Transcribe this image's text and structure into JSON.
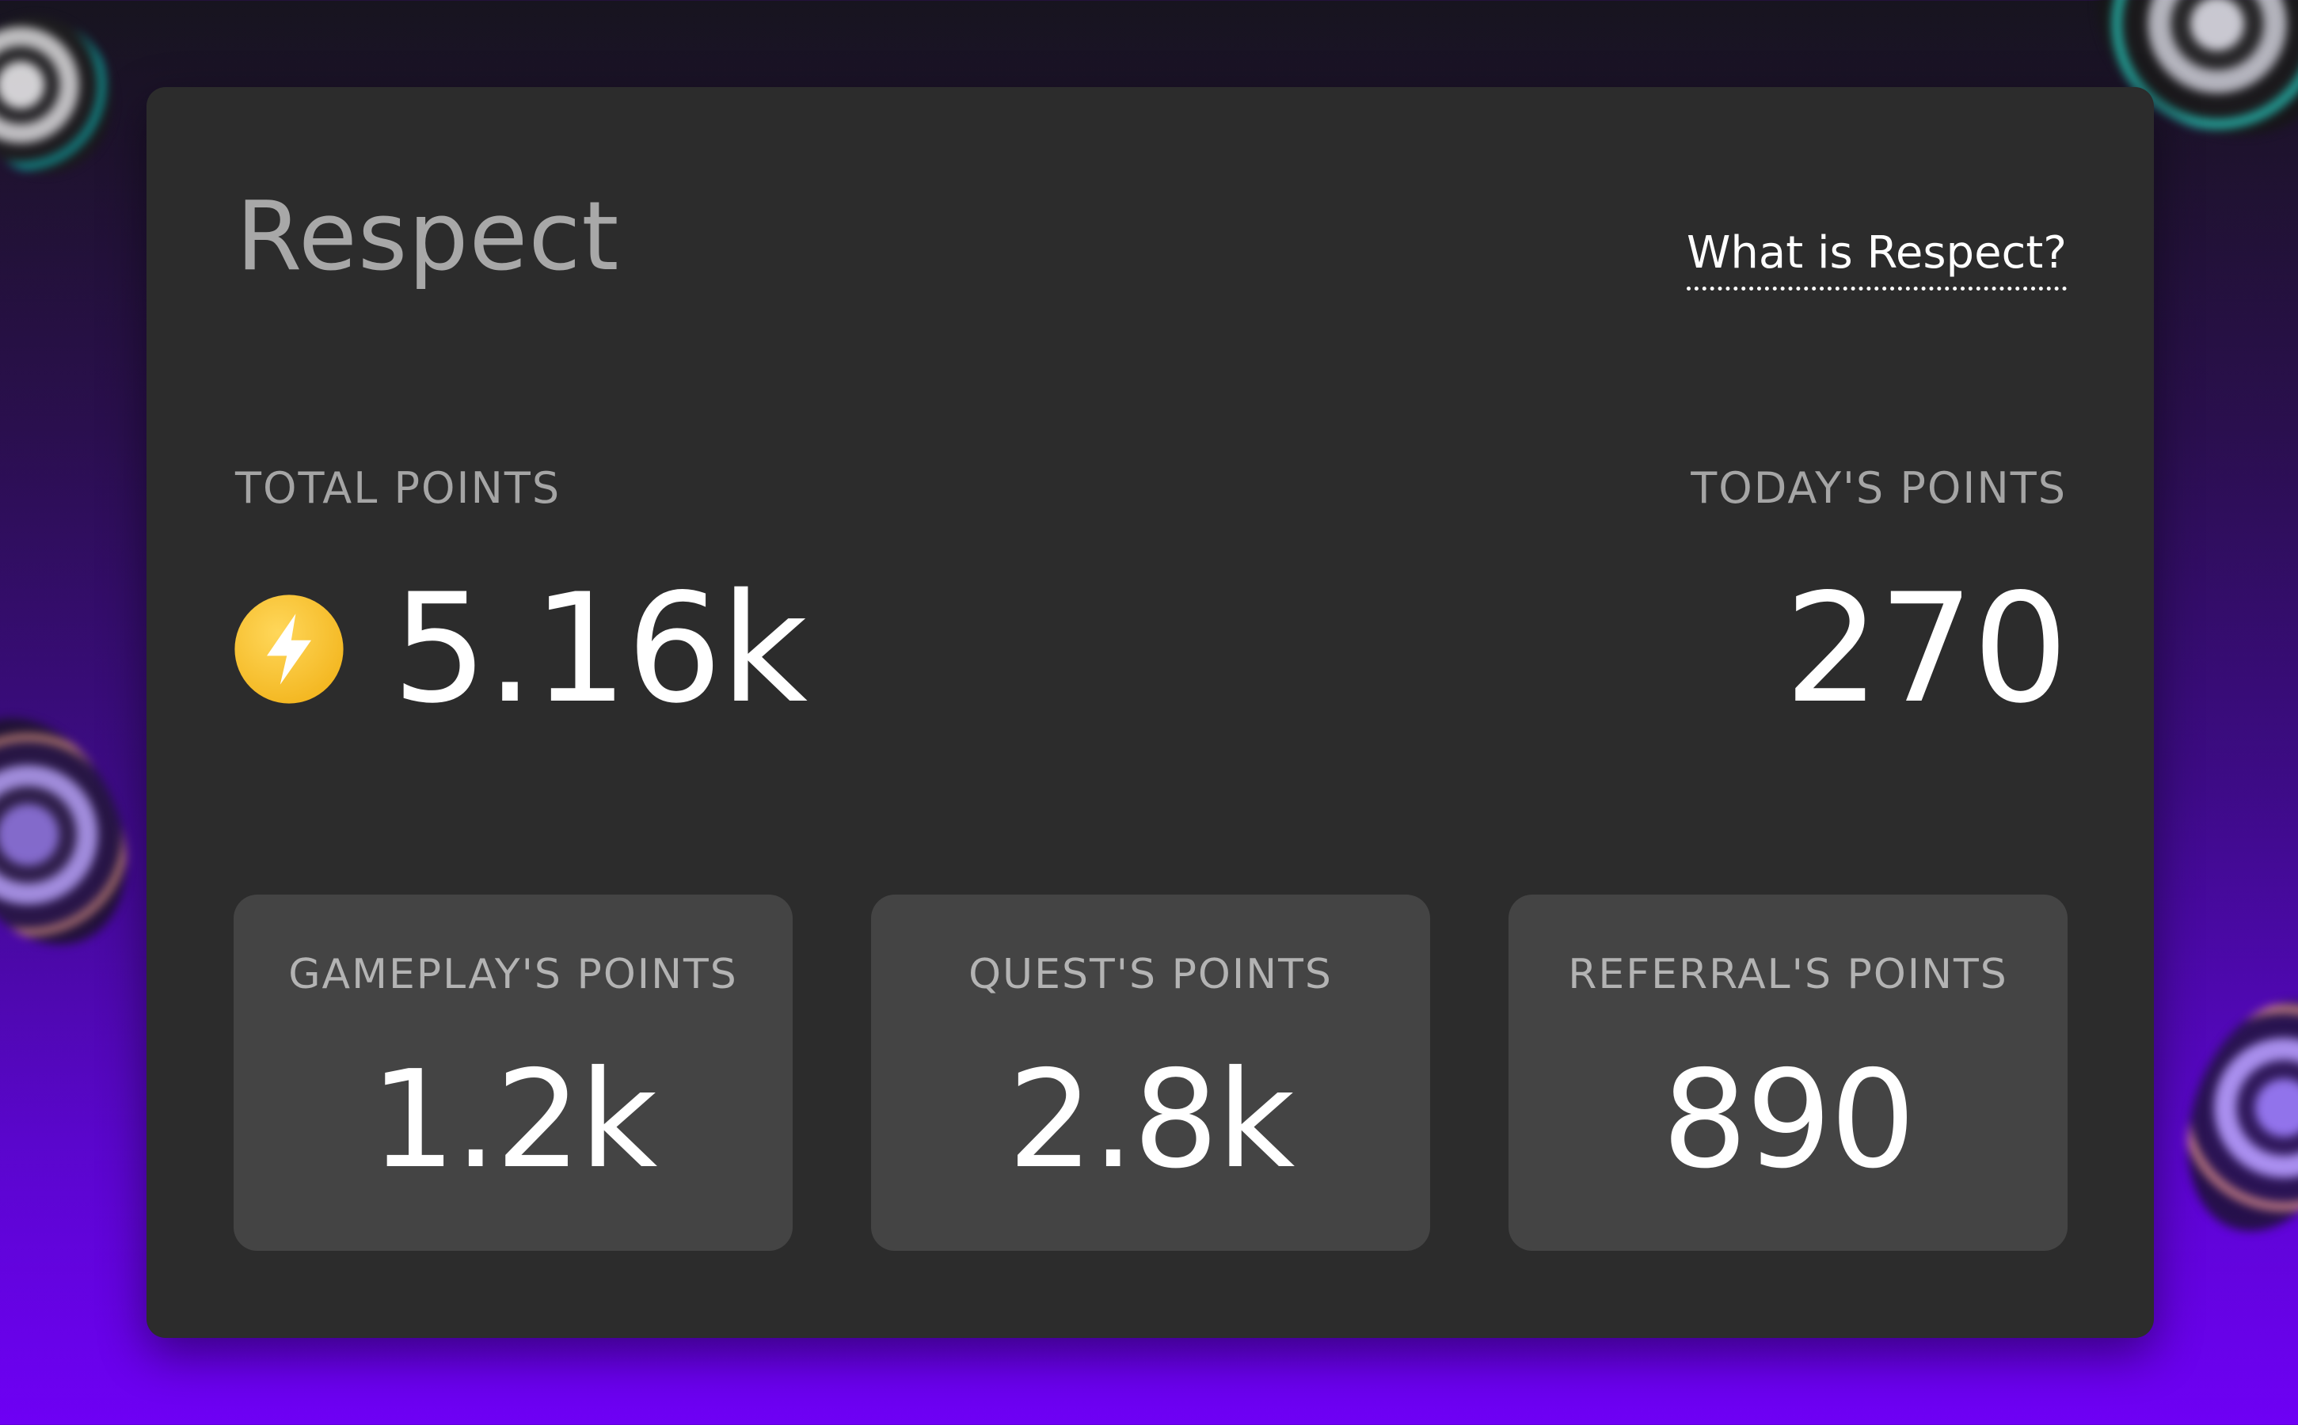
{
  "card": {
    "title": "Respect",
    "help_link": "What is Respect?"
  },
  "total": {
    "label": "TOTAL POINTS",
    "value": "5.16k",
    "icon": "lightning-bolt-coin-icon"
  },
  "today": {
    "label": "TODAY'S POINTS",
    "value": "270"
  },
  "breakdown": [
    {
      "label": "GAMEPLAY'S POINTS",
      "value": "1.2k"
    },
    {
      "label": "QUEST'S POINTS",
      "value": "2.8k"
    },
    {
      "label": "REFERRAL'S POINTS",
      "value": "890"
    }
  ],
  "colors": {
    "card_bg": "#2c2c2c",
    "tile_bg": "#444444",
    "coin": "#f7c531",
    "text_primary": "#ffffff",
    "text_muted": "#a5a5a5",
    "accent_bg": "#6e00f5"
  }
}
